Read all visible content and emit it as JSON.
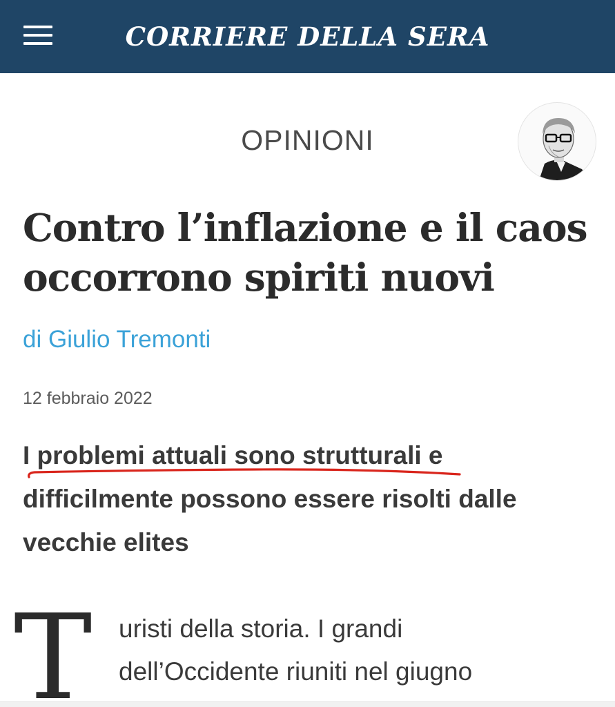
{
  "header": {
    "masthead": "CORRIERE DELLA SERA",
    "menu_icon": "hamburger-menu-icon",
    "background_color": "#1f4566"
  },
  "article": {
    "section": "OPINIONI",
    "headline": "Contro l’inflazione e il caos occorrono spiriti nuovi",
    "byline": "di Giulio Tremonti",
    "date": "12 febbraio 2022",
    "subtitle": "I problemi attuali sono strutturali e difficilmente possono essere risolti dalle vecchie elites",
    "drop_cap": "T",
    "body_lines": [
      "uristi della storia. I grandi",
      "dell’Occidente riuniti nel giugno"
    ],
    "byline_color": "#3ba2d8",
    "highlight_color": "#d9251c"
  }
}
